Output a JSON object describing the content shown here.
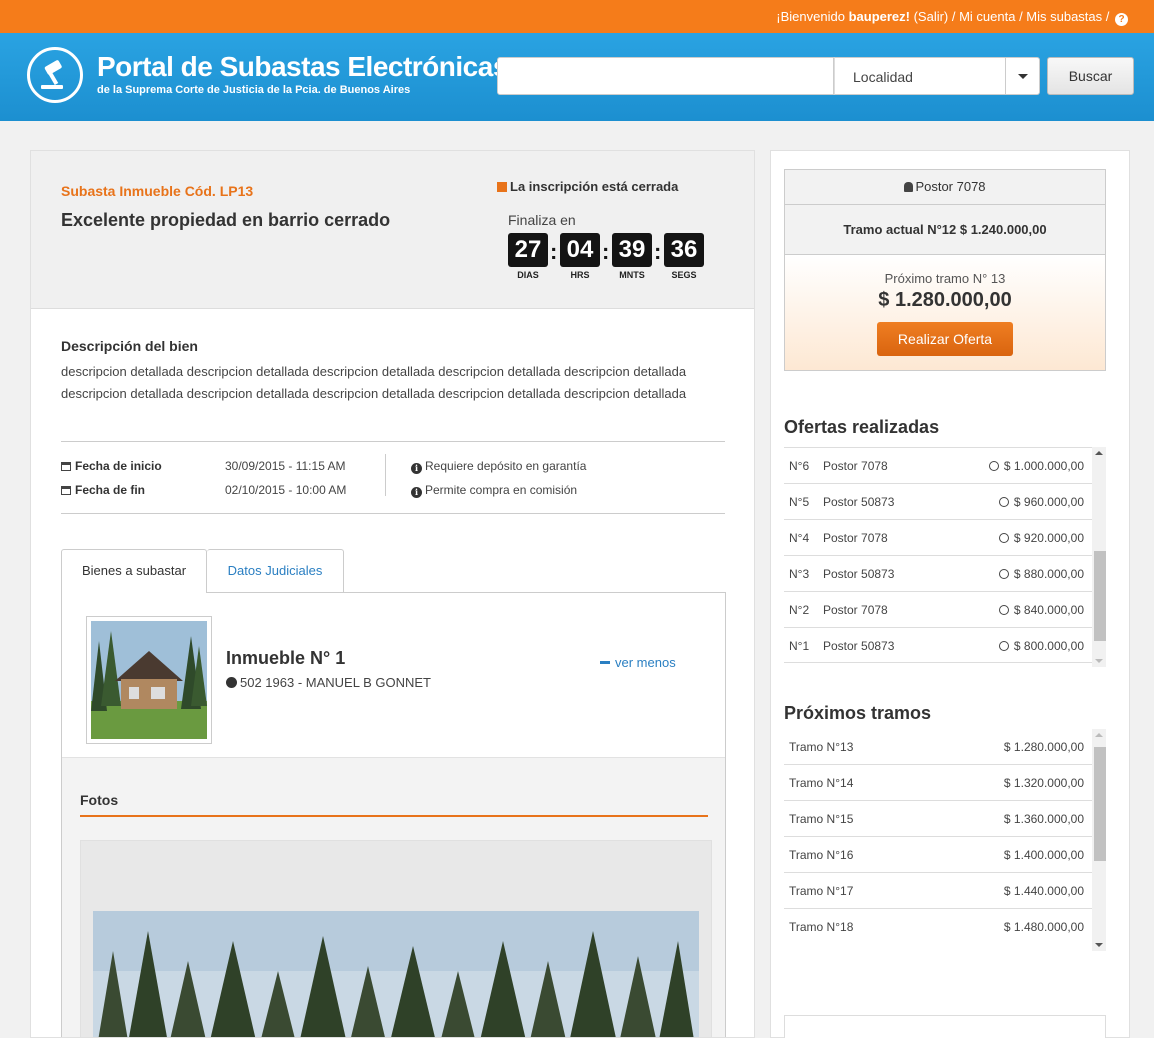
{
  "topbar": {
    "welcome": "¡Bienvenido ",
    "username": "bauperez!",
    "rest": " (Salir) / Mi cuenta / Mis subastas / "
  },
  "header": {
    "title": "Portal de Subastas Electrónicas",
    "subtitle": "de la Suprema Corte de Justicia de la Pcia. de Buenos Aires",
    "search_value": "",
    "location_label": "Localidad",
    "search_button": "Buscar"
  },
  "auction": {
    "code": "Subasta Inmueble Cód. LP13",
    "title": "Excelente propiedad en barrio cerrado",
    "closed_notice": "La inscripción está cerrada",
    "ends_label": "Finaliza en",
    "countdown": {
      "days": "27",
      "days_label": "DIAS",
      "hours": "04",
      "hours_label": "HRS",
      "minutes": "39",
      "minutes_label": "MNTS",
      "seconds": "36",
      "seconds_label": "SEGS"
    },
    "description_title": "Descripción del bien",
    "description": "descripcion detallada descripcion detallada descripcion detallada descripcion detallada descripcion detallada descripcion detallada descripcion detallada descripcion detallada descripcion detallada descripcion detallada",
    "start_label": "Fecha de inicio",
    "start_value": "30/09/2015 - 11:15 AM",
    "end_label": "Fecha de fin",
    "end_value": "02/10/2015 - 10:00 AM",
    "info_1": "Requiere depósito en garantía",
    "info_2": "Permite compra en comisión"
  },
  "tabs": {
    "tab_1": "Bienes a subastar",
    "tab_2": "Datos Judiciales"
  },
  "item": {
    "name": "Inmueble N° 1",
    "address": "502 1963 - MANUEL B GONNET",
    "toggle": "ver menos",
    "photos_title": "Fotos"
  },
  "side": {
    "bidder": "Postor 7078",
    "current_tramo": "Tramo actual N°12 $ 1.240.000,00",
    "next_label": "Próximo tramo N° 13",
    "next_amount": "$ 1.280.000,00",
    "offer_button": "Realizar Oferta",
    "offers_title": "Ofertas realizadas",
    "offers": [
      {
        "num": "N°6",
        "bidder": "Postor 7078",
        "amount": "$ 1.000.000,00"
      },
      {
        "num": "N°5",
        "bidder": "Postor 50873",
        "amount": "$ 960.000,00"
      },
      {
        "num": "N°4",
        "bidder": "Postor 7078",
        "amount": "$ 920.000,00"
      },
      {
        "num": "N°3",
        "bidder": "Postor 50873",
        "amount": "$ 880.000,00"
      },
      {
        "num": "N°2",
        "bidder": "Postor 7078",
        "amount": "$ 840.000,00"
      },
      {
        "num": "N°1",
        "bidder": "Postor 50873",
        "amount": "$ 800.000,00"
      }
    ],
    "tramos_title": "Próximos tramos",
    "tramos": [
      {
        "label": "Tramo N°13",
        "amount": "$ 1.280.000,00"
      },
      {
        "label": "Tramo N°14",
        "amount": "$ 1.320.000,00"
      },
      {
        "label": "Tramo N°15",
        "amount": "$ 1.360.000,00"
      },
      {
        "label": "Tramo N°16",
        "amount": "$ 1.400.000,00"
      },
      {
        "label": "Tramo N°17",
        "amount": "$ 1.440.000,00"
      },
      {
        "label": "Tramo N°18",
        "amount": "$ 1.480.000,00"
      }
    ]
  },
  "colors": {
    "accent_orange": "#f57c1a",
    "header_blue": "#1c8fd0",
    "link_blue": "#2a7fc2"
  }
}
